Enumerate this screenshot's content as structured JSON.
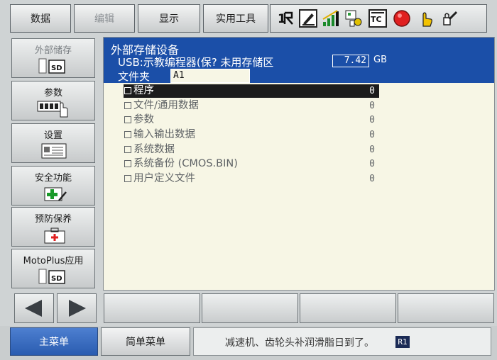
{
  "top_menu": {
    "data_label": "数据",
    "edit_label": "编辑",
    "view_label": "显示",
    "tools_label": "实用工具"
  },
  "status_icons": [
    "coordinate-icon",
    "job-edit-icon",
    "signal-strength-icon",
    "io-status-icon",
    "teach-mode-icon",
    "servo-stop-icon",
    "hand-touch-icon",
    "security-lock-icon"
  ],
  "left_menu": {
    "external_storage": "外部储存",
    "parameters": "参数",
    "settings": "设置",
    "safety": "安全功能",
    "maintenance": "预防保养",
    "motoplus": "MotoPlus应用"
  },
  "header": {
    "title": "外部存储设备",
    "device_line": "USB:示教编程器(保? 未用存储区",
    "free_space": "7.42",
    "unit": "GB",
    "folder_label": "文件夹",
    "folder_value": "A1"
  },
  "items": [
    {
      "name": "程序",
      "count": "0",
      "selected": true
    },
    {
      "name": "文件/通用数据",
      "count": "0"
    },
    {
      "name": "参数",
      "count": "0"
    },
    {
      "name": "输入输出数据",
      "count": "0"
    },
    {
      "name": "系统数据",
      "count": "0"
    },
    {
      "name": "系统备份 (CMOS.BIN)",
      "count": "0"
    },
    {
      "name": "用户定义文件",
      "count": "0"
    }
  ],
  "bottom": {
    "main_menu": "主菜单",
    "simple_menu": "简单菜单",
    "message": "减速机、齿轮头补润滑脂日到了。",
    "message_tag": "R1"
  },
  "colors": {
    "header_bg": "#1b4fa8",
    "panel_bg": "#f7f6e5",
    "main_menu_bg": "#2a5cb0",
    "servo_red": "#e02020"
  }
}
